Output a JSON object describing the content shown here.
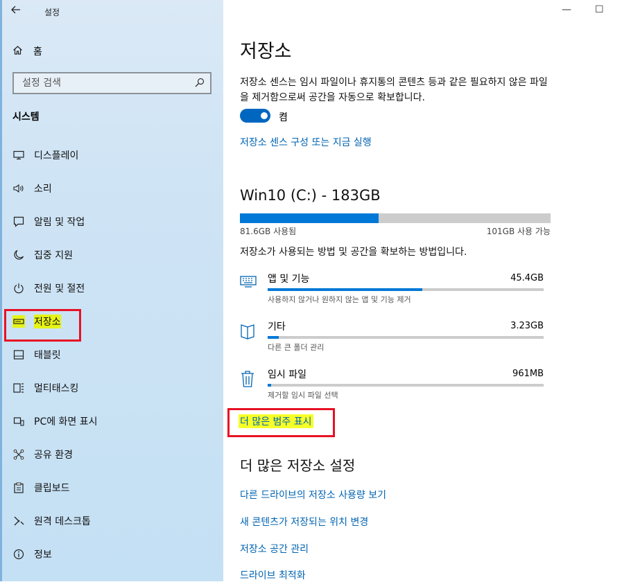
{
  "window": {
    "title": "설정",
    "minimize": "—",
    "maximize": "☐"
  },
  "sidebar": {
    "home_label": "홈",
    "search_placeholder": "설정 검색",
    "section": "시스템",
    "items": [
      {
        "label": "디스플레이",
        "icon": "monitor-icon"
      },
      {
        "label": "소리",
        "icon": "speaker-icon"
      },
      {
        "label": "알림 및 작업",
        "icon": "notification-icon"
      },
      {
        "label": "집중 지원",
        "icon": "moon-icon"
      },
      {
        "label": "전원 및 절전",
        "icon": "power-icon"
      },
      {
        "label": "저장소",
        "icon": "drive-icon",
        "active": true
      },
      {
        "label": "태블릿",
        "icon": "tablet-icon"
      },
      {
        "label": "멀티태스킹",
        "icon": "multitasking-icon"
      },
      {
        "label": "PC에 화면 표시",
        "icon": "project-icon"
      },
      {
        "label": "공유 환경",
        "icon": "share-icon"
      },
      {
        "label": "클립보드",
        "icon": "clipboard-icon"
      },
      {
        "label": "원격 데스크톱",
        "icon": "remote-desktop-icon"
      },
      {
        "label": "정보",
        "icon": "info-icon"
      }
    ]
  },
  "main": {
    "title": "저장소",
    "description": "저장소 센스는 임시 파일이나 휴지통의 콘텐츠 등과 같은 필요하지 않은 파일을 제거함으로써 공간을 자동으로 확보합니다.",
    "toggle_label": "켬",
    "toggle_on": true,
    "sense_link": "저장소 센스 구성 또는 지금 실행",
    "drive": {
      "title": "Win10 (C:) - 183GB",
      "used": "81.6GB 사용됨",
      "free": "101GB 사용 가능",
      "used_fraction": 0.446
    },
    "how_text": "저장소가 사용되는 방법 및 공간을 확보하는 방법입니다.",
    "categories": [
      {
        "name": "앱 및 기능",
        "size": "45.4GB",
        "sub": "사용하지 않거나 원하지 않는 앱 및 기능 제거",
        "fraction": 0.56,
        "icon": "apps-keyboard-icon"
      },
      {
        "name": "기타",
        "size": "3.23GB",
        "sub": "다른 큰 폴더 관리",
        "fraction": 0.04,
        "icon": "folder-icon"
      },
      {
        "name": "임시 파일",
        "size": "961MB",
        "sub": "제거할 임시 파일 선택",
        "fraction": 0.012,
        "icon": "trash-icon"
      }
    ],
    "more_categories": "더 많은 범주 표시",
    "more_settings_title": "더 많은 저장소 설정",
    "more_links": [
      "다른 드라이브의 저장소 사용량 보기",
      "새 콘텐츠가 저장되는 위치 변경",
      "저장소 공간 관리",
      "드라이브 최적화"
    ]
  },
  "colors": {
    "accent": "#0078d7",
    "link": "#0063b1",
    "highlight": "#e6f316",
    "annotation": "#e81123"
  }
}
